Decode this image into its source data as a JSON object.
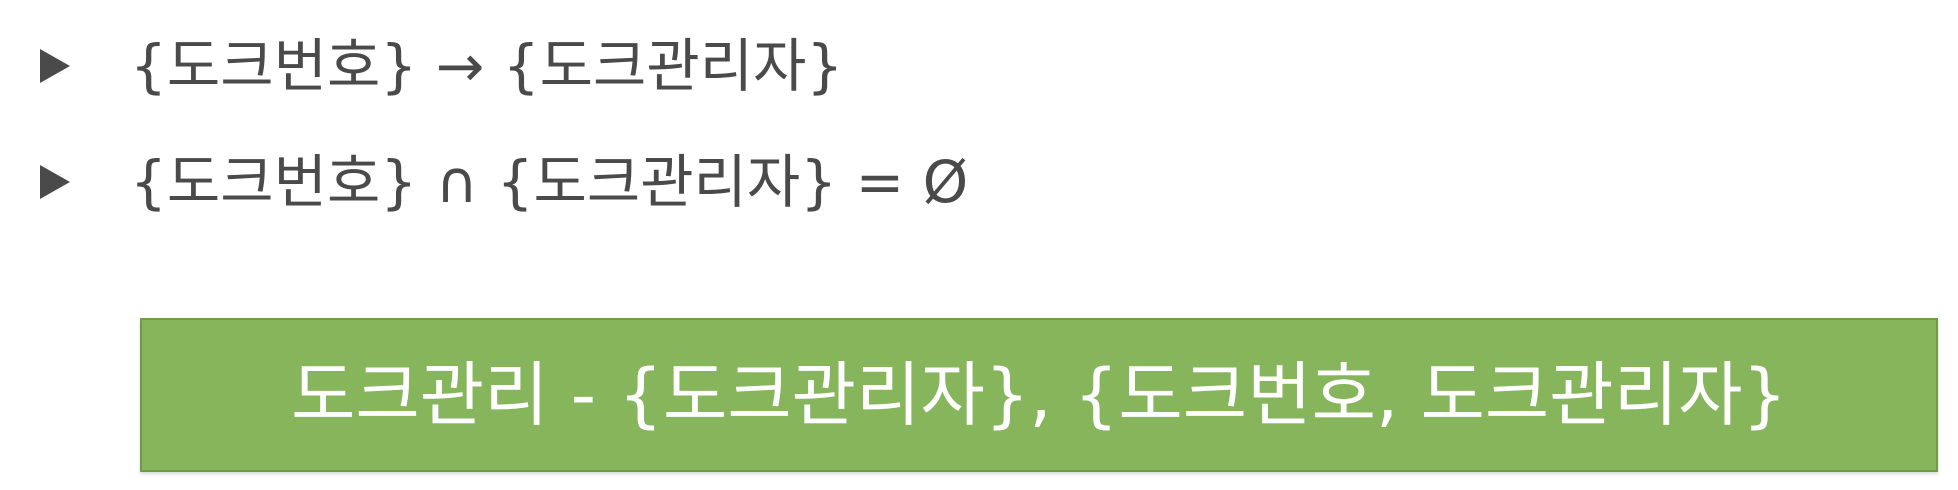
{
  "bullets": [
    {
      "text": "{도크번호} → {도크관리자}"
    },
    {
      "text": "{도크번호} ∩ {도크관리자} = Ø"
    }
  ],
  "highlight": {
    "text": "도크관리 - {도크관리자}, {도크번호, 도크관리자}"
  },
  "colors": {
    "bullet": "#4a4a4a",
    "box_fill": "#86b55c",
    "box_text": "#ffffff"
  }
}
